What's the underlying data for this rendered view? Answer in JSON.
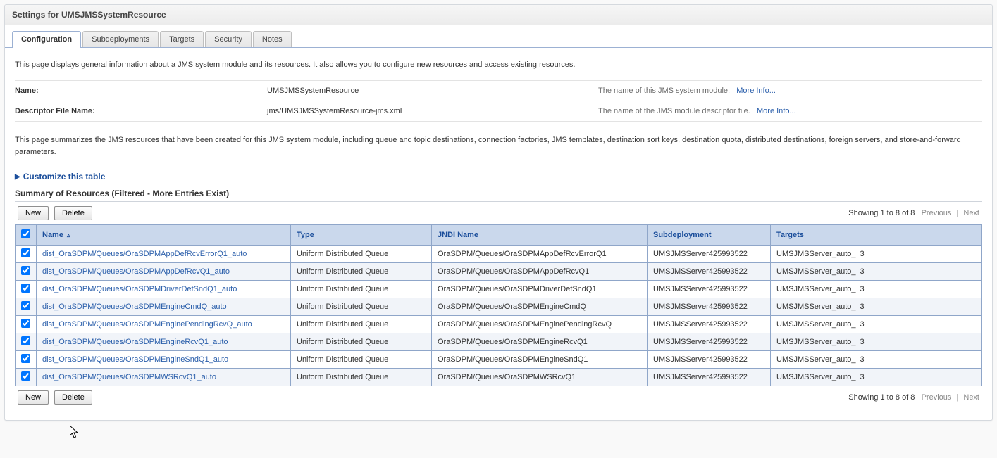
{
  "title": "Settings for UMSJMSSystemResource",
  "tabs": [
    {
      "label": "Configuration",
      "active": true
    },
    {
      "label": "Subdeployments",
      "active": false
    },
    {
      "label": "Targets",
      "active": false
    },
    {
      "label": "Security",
      "active": false
    },
    {
      "label": "Notes",
      "active": false
    }
  ],
  "desc1": "This page displays general information about a JMS system module and its resources. It also allows you to configure new resources and access existing resources.",
  "info": {
    "name_label": "Name:",
    "name_value": "UMSJMSSystemResource",
    "name_hint": "The name of this JMS system module.",
    "more_info": "More Info...",
    "desc_label": "Descriptor File Name:",
    "desc_value": "jms/UMSJMSSystemResource-jms.xml",
    "desc_hint": "The name of the JMS module descriptor file."
  },
  "desc2": "This page summarizes the JMS resources that have been created for this JMS system module, including queue and topic destinations, connection factories, JMS templates, destination sort keys, destination quota, distributed destinations, foreign servers, and store-and-forward parameters.",
  "customize": "Customize this table",
  "summary_title": "Summary of Resources (Filtered - More Entries Exist)",
  "toolbar": {
    "new": "New",
    "delete": "Delete"
  },
  "pager": {
    "showing": "Showing 1 to 8 of 8",
    "prev": "Previous",
    "next": "Next"
  },
  "cols": {
    "name": "Name",
    "type": "Type",
    "jndi": "JNDI Name",
    "subd": "Subdeployment",
    "targets": "Targets"
  },
  "rows": [
    {
      "name": "dist_OraSDPM/Queues/OraSDPMAppDefRcvErrorQ1_auto",
      "type": "Uniform Distributed Queue",
      "jndi": "OraSDPM/Queues/OraSDPMAppDefRcvErrorQ1",
      "subd": "UMSJMSServer425993522",
      "targets": "UMSJMSServer_auto_",
      "suffix": "3"
    },
    {
      "name": "dist_OraSDPM/Queues/OraSDPMAppDefRcvQ1_auto",
      "type": "Uniform Distributed Queue",
      "jndi": "OraSDPM/Queues/OraSDPMAppDefRcvQ1",
      "subd": "UMSJMSServer425993522",
      "targets": "UMSJMSServer_auto_",
      "suffix": "3"
    },
    {
      "name": "dist_OraSDPM/Queues/OraSDPMDriverDefSndQ1_auto",
      "type": "Uniform Distributed Queue",
      "jndi": "OraSDPM/Queues/OraSDPMDriverDefSndQ1",
      "subd": "UMSJMSServer425993522",
      "targets": "UMSJMSServer_auto_",
      "suffix": "3"
    },
    {
      "name": "dist_OraSDPM/Queues/OraSDPMEngineCmdQ_auto",
      "type": "Uniform Distributed Queue",
      "jndi": "OraSDPM/Queues/OraSDPMEngineCmdQ",
      "subd": "UMSJMSServer425993522",
      "targets": "UMSJMSServer_auto_",
      "suffix": "3"
    },
    {
      "name": "dist_OraSDPM/Queues/OraSDPMEnginePendingRcvQ_auto",
      "type": "Uniform Distributed Queue",
      "jndi": "OraSDPM/Queues/OraSDPMEnginePendingRcvQ",
      "subd": "UMSJMSServer425993522",
      "targets": "UMSJMSServer_auto_",
      "suffix": "3"
    },
    {
      "name": "dist_OraSDPM/Queues/OraSDPMEngineRcvQ1_auto",
      "type": "Uniform Distributed Queue",
      "jndi": "OraSDPM/Queues/OraSDPMEngineRcvQ1",
      "subd": "UMSJMSServer425993522",
      "targets": "UMSJMSServer_auto_",
      "suffix": "3"
    },
    {
      "name": "dist_OraSDPM/Queues/OraSDPMEngineSndQ1_auto",
      "type": "Uniform Distributed Queue",
      "jndi": "OraSDPM/Queues/OraSDPMEngineSndQ1",
      "subd": "UMSJMSServer425993522",
      "targets": "UMSJMSServer_auto_",
      "suffix": "3"
    },
    {
      "name": "dist_OraSDPM/Queues/OraSDPMWSRcvQ1_auto",
      "type": "Uniform Distributed Queue",
      "jndi": "OraSDPM/Queues/OraSDPMWSRcvQ1",
      "subd": "UMSJMSServer425993522",
      "targets": "UMSJMSServer_auto_",
      "suffix": "3"
    }
  ]
}
